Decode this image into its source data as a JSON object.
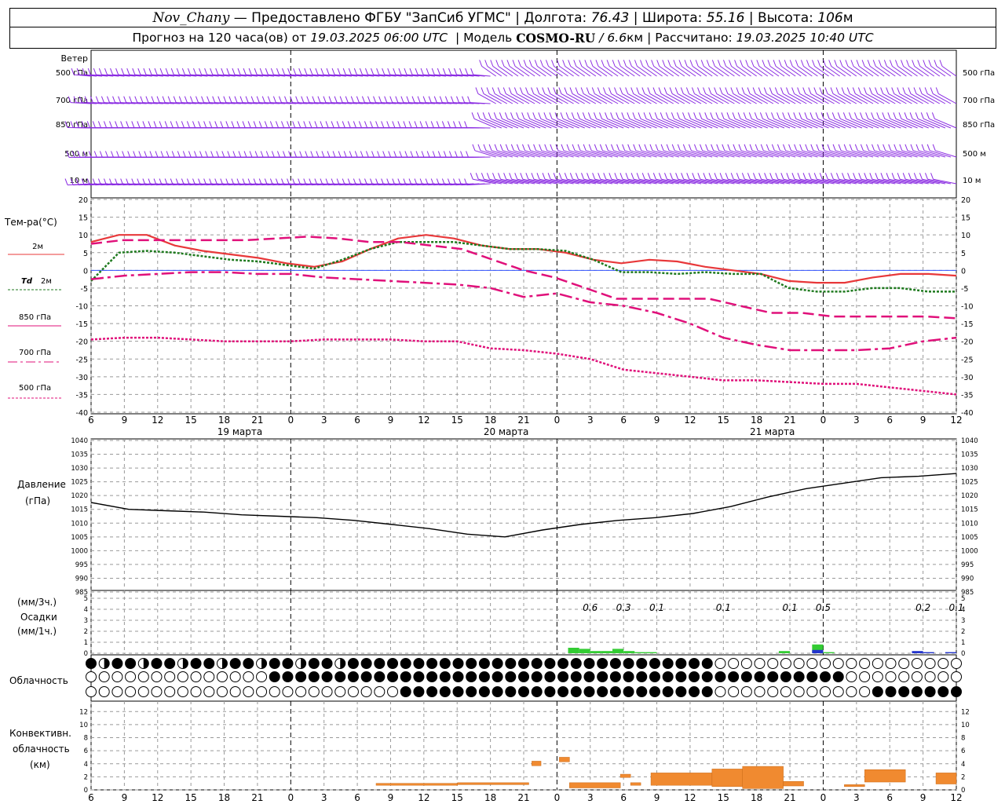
{
  "header": {
    "station": "Nov_Chany",
    "provider": "— Предоставлено ФГБУ \"ЗапСиб УГМС\" |",
    "lon_label": "Долгота:",
    "lon_value": "76.43",
    "lat_label": "| Широта:",
    "lat_value": "55.16",
    "alt_label": "| Высота:",
    "alt_value": "106",
    "alt_unit": "м",
    "forecast_prefix": "Прогноз на 120 часа(ов) от",
    "forecast_start": "19.03.2025 06:00 UTC",
    "model_label": "| Модель",
    "model_name": "COSMO-RU",
    "model_res": "/ 6.6",
    "model_res_unit": "км",
    "calc_label": "| Рассчитано:",
    "calc_time": "19.03.2025 10:40 UTC"
  },
  "labels": {
    "wind": "Ветер",
    "wind_levels": [
      "500 гПа",
      "700 гПа",
      "850 гПа",
      "500 м",
      "10 м"
    ],
    "temp": "Тем-ра(°C)",
    "t2m": "2м",
    "td": "Td",
    "td_unit": "2м",
    "t850": "850 гПа",
    "t700": "700 гПа",
    "t500": "500 гПа",
    "pressure": "Давление",
    "pressure_unit": "(гПа)",
    "precip_top": "(мм/3ч.)",
    "precip": "Осадки",
    "precip_bottom": "(мм/1ч.)",
    "cloud": "Облачность",
    "conv1": "Конвективн.",
    "conv2": "облачность",
    "conv3": "(км)"
  },
  "axis": {
    "hour_labels": [
      "6",
      "9",
      "12",
      "15",
      "18",
      "21",
      "0",
      "3",
      "6",
      "9",
      "12",
      "15",
      "18",
      "21",
      "0",
      "3",
      "6",
      "9",
      "12",
      "15",
      "18",
      "21",
      "0",
      "3",
      "6",
      "9",
      "12"
    ],
    "day_labels": [
      "19 марта",
      "20 марта",
      "21 марта"
    ],
    "temp_ticks": [
      20,
      15,
      10,
      5,
      0,
      -5,
      -10,
      -15,
      -20,
      -25,
      -30,
      -35,
      -40
    ],
    "pressure_ticks": [
      1040,
      1035,
      1030,
      1025,
      1020,
      1015,
      1010,
      1005,
      1000,
      995,
      990,
      985
    ],
    "precip_ticks": [
      5,
      4,
      3,
      2,
      1,
      0
    ],
    "conv_ticks": [
      12,
      10,
      8,
      6,
      4,
      2,
      0
    ]
  },
  "colors": {
    "t2m": "#e8383a",
    "td": "#1f7a1f",
    "levels": "#e0107a",
    "zero": "#3355ff",
    "wind": "#8a2be2",
    "precip_green": "#33cc33",
    "precip_blue": "#2233cc",
    "conv": "#f08a30"
  },
  "chart_data": {
    "type": "line",
    "x_hours": [
      0,
      3,
      6,
      9,
      12,
      15,
      18,
      21,
      24,
      27,
      30,
      33,
      36,
      39,
      42,
      45,
      48,
      51,
      54,
      57,
      60,
      63,
      66,
      69,
      72,
      75,
      78
    ],
    "temperature": {
      "ylim": [
        -40,
        20
      ],
      "series": [
        {
          "name": "2м",
          "values": [
            8,
            10,
            10,
            7,
            5.5,
            4.5,
            3.5,
            2,
            1,
            2.5,
            6,
            9,
            10,
            9,
            7,
            6,
            6,
            5,
            3,
            2,
            3,
            2.5,
            1,
            0,
            -1,
            -3,
            -3.5,
            -3.5,
            -2,
            -1,
            -1,
            -1.5
          ]
        },
        {
          "name": "Td 2м",
          "values": [
            -3,
            5,
            5.5,
            5,
            4,
            3,
            2.5,
            1.5,
            0.5,
            3,
            6,
            8,
            8,
            8,
            7,
            6,
            6,
            5.5,
            3,
            -0.5,
            -0.5,
            -1,
            -0.5,
            -1,
            -1,
            -5,
            -6,
            -6,
            -5,
            -5,
            -6,
            -6
          ]
        },
        {
          "name": "850 гПа",
          "values": [
            7.5,
            8.5,
            8.5,
            8.5,
            8.5,
            8.5,
            9,
            9.5,
            9,
            8,
            8,
            7,
            6,
            3,
            0,
            -2,
            -5,
            -8,
            -8,
            -8,
            -8,
            -10,
            -12,
            -12,
            -13,
            -13,
            -13,
            -13,
            -13.5
          ]
        },
        {
          "name": "700 гПа",
          "values": [
            -2.5,
            -1.5,
            -1,
            -0.5,
            -0.5,
            -1,
            -1,
            -2,
            -2.5,
            -3,
            -3.5,
            -4,
            -5,
            -7.5,
            -6.5,
            -9,
            -10,
            -12,
            -15,
            -19,
            -21,
            -22.5,
            -22.5,
            -22.5,
            -22,
            -20,
            -19
          ]
        },
        {
          "name": "500 гПа",
          "values": [
            -19.5,
            -19,
            -19,
            -19.5,
            -20,
            -20,
            -20,
            -19.5,
            -19.5,
            -19.5,
            -20,
            -20,
            -22,
            -22.5,
            -23.5,
            -25,
            -28,
            -29,
            -30,
            -31,
            -31,
            -31.5,
            -32,
            -32,
            -33,
            -34,
            -35
          ]
        }
      ]
    },
    "pressure": {
      "ylim": [
        985,
        1040
      ],
      "values": [
        1017.5,
        1015,
        1014.5,
        1014,
        1013,
        1012.5,
        1012,
        1011,
        1009.5,
        1008,
        1006,
        1005,
        1007.5,
        1009.5,
        1011,
        1012,
        1013.5,
        1016,
        1019.5,
        1022.5,
        1024.5,
        1026.5,
        1027,
        1028
      ]
    },
    "precip_labels": [
      {
        "hour": 45,
        "text": "0.6"
      },
      {
        "hour": 48,
        "text": "0.3"
      },
      {
        "hour": 51,
        "text": "0.1"
      },
      {
        "hour": 57,
        "text": "0.1"
      },
      {
        "hour": 63,
        "text": "0.1"
      },
      {
        "hour": 66,
        "text": "0.5"
      },
      {
        "hour": 75,
        "text": "0.2"
      },
      {
        "hour": 78,
        "text": "0.1"
      }
    ],
    "precip_bars": [
      {
        "hour": 43.5,
        "mm": 0.5,
        "kind": "green"
      },
      {
        "hour": 44.5,
        "mm": 0.4,
        "kind": "green"
      },
      {
        "hour": 45.5,
        "mm": 0.2,
        "kind": "green"
      },
      {
        "hour": 46.5,
        "mm": 0.2,
        "kind": "green"
      },
      {
        "hour": 47.5,
        "mm": 0.4,
        "kind": "green"
      },
      {
        "hour": 48.5,
        "mm": 0.2,
        "kind": "green"
      },
      {
        "hour": 49.5,
        "mm": 0.1,
        "kind": "green"
      },
      {
        "hour": 50.5,
        "mm": 0.1,
        "kind": "green"
      },
      {
        "hour": 62.5,
        "mm": 0.2,
        "kind": "green"
      },
      {
        "hour": 65.5,
        "mm": 0.8,
        "kind": "green"
      },
      {
        "hour": 65.5,
        "mm": 0.3,
        "kind": "blue"
      },
      {
        "hour": 66.5,
        "mm": 0.1,
        "kind": "green"
      },
      {
        "hour": 74.5,
        "mm": 0.2,
        "kind": "blue"
      },
      {
        "hour": 75.5,
        "mm": 0.1,
        "kind": "blue"
      },
      {
        "hour": 77.5,
        "mm": 0.1,
        "kind": "blue"
      }
    ],
    "convective_km": [
      {
        "from": 28,
        "to": 36,
        "top": 1,
        "bottom": 0.7
      },
      {
        "from": 36,
        "to": 43,
        "top": 1.1,
        "bottom": 0.8
      },
      {
        "from": 43.3,
        "to": 44.2,
        "top": 4.4,
        "bottom": 3.7
      },
      {
        "from": 46,
        "to": 47,
        "top": 5,
        "bottom": 4.3
      },
      {
        "from": 47,
        "to": 52,
        "top": 1.1,
        "bottom": 0.3
      },
      {
        "from": 52,
        "to": 53,
        "top": 2.4,
        "bottom": 1.9
      },
      {
        "from": 53,
        "to": 54,
        "top": 1.1,
        "bottom": 0.7
      },
      {
        "from": 55,
        "to": 61,
        "top": 2.6,
        "bottom": 0.7
      },
      {
        "from": 61,
        "to": 64,
        "top": 3.2,
        "bottom": 0.5
      },
      {
        "from": 64,
        "to": 68,
        "top": 3.6,
        "bottom": 0.2
      },
      {
        "from": 68,
        "to": 70,
        "top": 1.3,
        "bottom": 0.6
      },
      {
        "from": 74,
        "to": 76,
        "top": 0.8,
        "bottom": 0.5
      },
      {
        "from": 76,
        "to": 80,
        "top": 3.1,
        "bottom": 1.2
      },
      {
        "from": 83,
        "to": 85,
        "top": 2.6,
        "bottom": 0.9
      }
    ],
    "wind_regimes": [
      {
        "from": 0,
        "to": 36,
        "dir": "west"
      },
      {
        "from": 36,
        "to": 78,
        "dir": "northwest"
      }
    ]
  }
}
